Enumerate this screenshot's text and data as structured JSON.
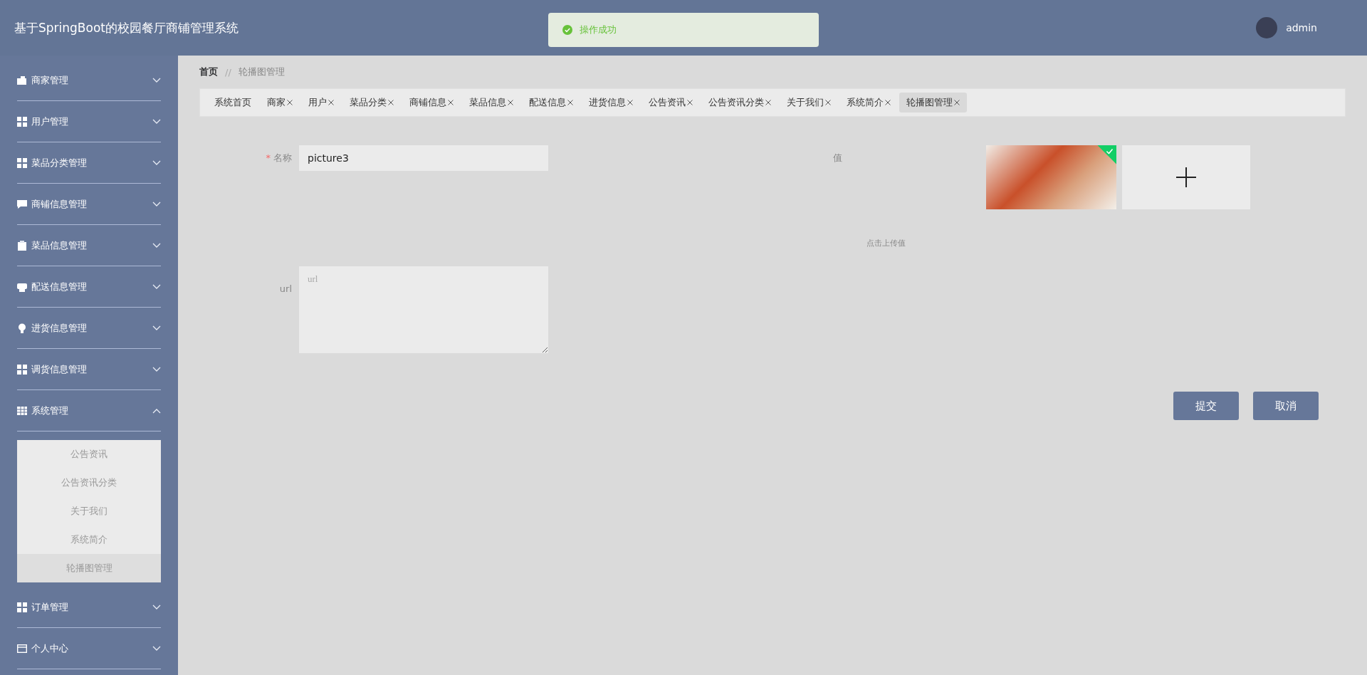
{
  "header": {
    "title": "基于SpringBoot的校园餐厅商铺管理系统",
    "user": "admin"
  },
  "toast": {
    "message": "操作成功"
  },
  "sidebar": {
    "items": [
      {
        "label": "商家管理",
        "kind": "store",
        "expanded": false
      },
      {
        "label": "用户管理",
        "kind": "grid",
        "expanded": false
      },
      {
        "label": "菜品分类管理",
        "kind": "grid",
        "expanded": false
      },
      {
        "label": "商铺信息管理",
        "kind": "chat",
        "expanded": false
      },
      {
        "label": "菜品信息管理",
        "kind": "clipboard",
        "expanded": false
      },
      {
        "label": "配送信息管理",
        "kind": "printer",
        "expanded": false
      },
      {
        "label": "进货信息管理",
        "kind": "bulb",
        "expanded": false
      },
      {
        "label": "调货信息管理",
        "kind": "grid",
        "expanded": false
      },
      {
        "label": "系统管理",
        "kind": "table",
        "expanded": true,
        "children": [
          {
            "label": "公告资讯",
            "selected": false
          },
          {
            "label": "公告资讯分类",
            "selected": false
          },
          {
            "label": "关于我们",
            "selected": false
          },
          {
            "label": "系统简介",
            "selected": false
          },
          {
            "label": "轮播图管理",
            "selected": true
          }
        ]
      },
      {
        "label": "订单管理",
        "kind": "grid",
        "expanded": false
      },
      {
        "label": "个人中心",
        "kind": "card",
        "expanded": false
      }
    ]
  },
  "breadcrumb": {
    "home": "首页",
    "separator": "//",
    "current": "轮播图管理"
  },
  "tabs": [
    {
      "label": "系统首页",
      "closable": false,
      "selected": false
    },
    {
      "label": "商家",
      "closable": true,
      "selected": false
    },
    {
      "label": "用户",
      "closable": true,
      "selected": false
    },
    {
      "label": "菜品分类",
      "closable": true,
      "selected": false
    },
    {
      "label": "商铺信息",
      "closable": true,
      "selected": false
    },
    {
      "label": "菜品信息",
      "closable": true,
      "selected": false
    },
    {
      "label": "配送信息",
      "closable": true,
      "selected": false
    },
    {
      "label": "进货信息",
      "closable": true,
      "selected": false
    },
    {
      "label": "公告资讯",
      "closable": true,
      "selected": false
    },
    {
      "label": "公告资讯分类",
      "closable": true,
      "selected": false
    },
    {
      "label": "关于我们",
      "closable": true,
      "selected": false
    },
    {
      "label": "系统简介",
      "closable": true,
      "selected": false
    },
    {
      "label": "轮播图管理",
      "closable": true,
      "selected": true
    }
  ],
  "form": {
    "name": {
      "label": "名称",
      "required_mark": "*",
      "value": "picture3"
    },
    "value": {
      "label": "值",
      "hint": "点击上传值",
      "uploaded": true
    },
    "url": {
      "label": "url",
      "placeholder": "url"
    },
    "buttons": [
      {
        "label": "提交"
      },
      {
        "label": "取消"
      }
    ]
  }
}
